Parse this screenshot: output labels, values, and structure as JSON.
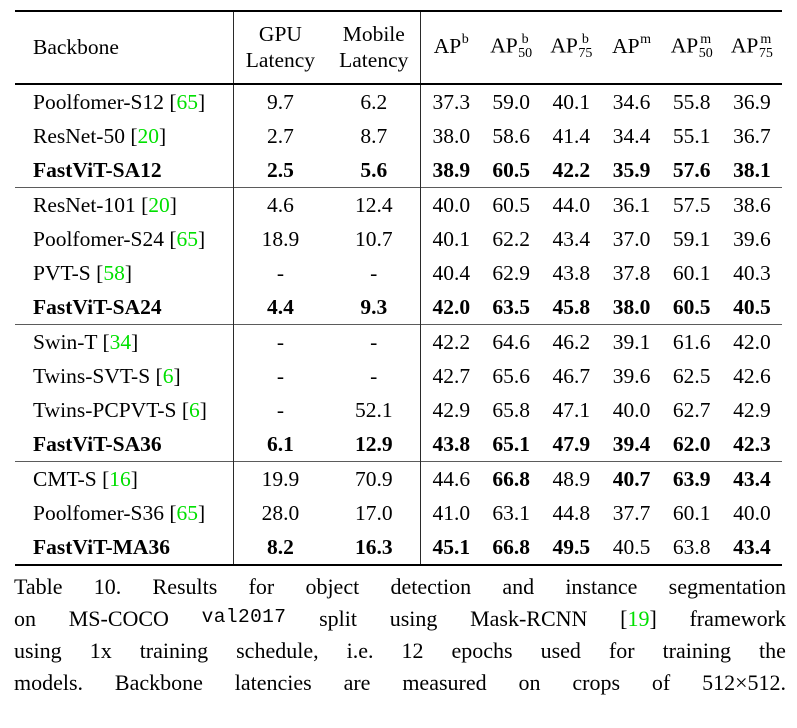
{
  "table": {
    "number": "Table 10",
    "headers": {
      "backbone": "Backbone",
      "gpu_latency": [
        "GPU",
        "Latency"
      ],
      "mobile_latency": [
        "Mobile",
        "Latency"
      ],
      "metrics": [
        {
          "base": "AP",
          "sup": "b",
          "sub": ""
        },
        {
          "base": "AP",
          "sup": "b",
          "sub": "50"
        },
        {
          "base": "AP",
          "sup": "b",
          "sub": "75"
        },
        {
          "base": "AP",
          "sup": "m",
          "sub": ""
        },
        {
          "base": "AP",
          "sup": "m",
          "sub": "50"
        },
        {
          "base": "AP",
          "sup": "m",
          "sub": "75"
        }
      ]
    },
    "groups": [
      {
        "rows": [
          {
            "name": "Poolfomer-S12",
            "cite": "65",
            "bold_name": false,
            "gpu": "9.7",
            "mobile": "6.2",
            "bold_latency": false,
            "values": [
              "37.3",
              "59.0",
              "40.1",
              "34.6",
              "55.8",
              "36.9"
            ],
            "bold_values": [
              false,
              false,
              false,
              false,
              false,
              false
            ]
          },
          {
            "name": "ResNet-50",
            "cite": "20",
            "bold_name": false,
            "gpu": "2.7",
            "mobile": "8.7",
            "bold_latency": false,
            "values": [
              "38.0",
              "58.6",
              "41.4",
              "34.4",
              "55.1",
              "36.7"
            ],
            "bold_values": [
              false,
              false,
              false,
              false,
              false,
              false
            ]
          },
          {
            "name": "FastViT-SA12",
            "cite": "",
            "bold_name": true,
            "gpu": "2.5",
            "mobile": "5.6",
            "bold_latency": true,
            "values": [
              "38.9",
              "60.5",
              "42.2",
              "35.9",
              "57.6",
              "38.1"
            ],
            "bold_values": [
              true,
              true,
              true,
              true,
              true,
              true
            ]
          }
        ]
      },
      {
        "rows": [
          {
            "name": "ResNet-101",
            "cite": "20",
            "bold_name": false,
            "gpu": "4.6",
            "mobile": "12.4",
            "bold_latency": false,
            "values": [
              "40.0",
              "60.5",
              "44.0",
              "36.1",
              "57.5",
              "38.6"
            ],
            "bold_values": [
              false,
              false,
              false,
              false,
              false,
              false
            ]
          },
          {
            "name": "Poolfomer-S24",
            "cite": "65",
            "bold_name": false,
            "gpu": "18.9",
            "mobile": "10.7",
            "bold_latency": false,
            "values": [
              "40.1",
              "62.2",
              "43.4",
              "37.0",
              "59.1",
              "39.6"
            ],
            "bold_values": [
              false,
              false,
              false,
              false,
              false,
              false
            ]
          },
          {
            "name": "PVT-S",
            "cite": "58",
            "bold_name": false,
            "gpu": "-",
            "mobile": "-",
            "bold_latency": false,
            "values": [
              "40.4",
              "62.9",
              "43.8",
              "37.8",
              "60.1",
              "40.3"
            ],
            "bold_values": [
              false,
              false,
              false,
              false,
              false,
              false
            ]
          },
          {
            "name": "FastViT-SA24",
            "cite": "",
            "bold_name": true,
            "gpu": "4.4",
            "mobile": "9.3",
            "bold_latency": true,
            "values": [
              "42.0",
              "63.5",
              "45.8",
              "38.0",
              "60.5",
              "40.5"
            ],
            "bold_values": [
              true,
              true,
              true,
              true,
              true,
              true
            ]
          }
        ]
      },
      {
        "rows": [
          {
            "name": "Swin-T",
            "cite": "34",
            "bold_name": false,
            "gpu": "-",
            "mobile": "-",
            "bold_latency": false,
            "values": [
              "42.2",
              "64.6",
              "46.2",
              "39.1",
              "61.6",
              "42.0"
            ],
            "bold_values": [
              false,
              false,
              false,
              false,
              false,
              false
            ]
          },
          {
            "name": "Twins-SVT-S",
            "cite": "6",
            "bold_name": false,
            "gpu": "-",
            "mobile": "-",
            "bold_latency": false,
            "values": [
              "42.7",
              "65.6",
              "46.7",
              "39.6",
              "62.5",
              "42.6"
            ],
            "bold_values": [
              false,
              false,
              false,
              false,
              false,
              false
            ]
          },
          {
            "name": "Twins-PCPVT-S",
            "cite": "6",
            "bold_name": false,
            "gpu": "-",
            "mobile": "52.1",
            "bold_latency": false,
            "values": [
              "42.9",
              "65.8",
              "47.1",
              "40.0",
              "62.7",
              "42.9"
            ],
            "bold_values": [
              false,
              false,
              false,
              false,
              false,
              false
            ]
          },
          {
            "name": "FastViT-SA36",
            "cite": "",
            "bold_name": true,
            "gpu": "6.1",
            "mobile": "12.9",
            "bold_latency": true,
            "values": [
              "43.8",
              "65.1",
              "47.9",
              "39.4",
              "62.0",
              "42.3"
            ],
            "bold_values": [
              true,
              true,
              true,
              true,
              true,
              true
            ]
          }
        ]
      },
      {
        "rows": [
          {
            "name": "CMT-S",
            "cite": "16",
            "bold_name": false,
            "gpu": "19.9",
            "mobile": "70.9",
            "bold_latency": false,
            "values": [
              "44.6",
              "66.8",
              "48.9",
              "40.7",
              "63.9",
              "43.4"
            ],
            "bold_values": [
              false,
              true,
              false,
              true,
              true,
              true
            ]
          },
          {
            "name": "Poolfomer-S36",
            "cite": "65",
            "bold_name": false,
            "gpu": "28.0",
            "mobile": "17.0",
            "bold_latency": false,
            "values": [
              "41.0",
              "63.1",
              "44.8",
              "37.7",
              "60.1",
              "40.0"
            ],
            "bold_values": [
              false,
              false,
              false,
              false,
              false,
              false
            ]
          },
          {
            "name": "FastViT-MA36",
            "cite": "",
            "bold_name": true,
            "gpu": "8.2",
            "mobile": "16.3",
            "bold_latency": true,
            "values": [
              "45.1",
              "66.8",
              "49.5",
              "40.5",
              "63.8",
              "43.4"
            ],
            "bold_values": [
              true,
              true,
              true,
              false,
              false,
              true
            ]
          }
        ]
      }
    ]
  },
  "caption": {
    "line1": "Table 10.  Results for object detection and instance segmentation",
    "line2_a": "on MS-COCO",
    "line2_mono": "val2017",
    "line2_b": "split using Mask-RCNN",
    "line2_cite": "19",
    "line2_c": "framework",
    "line3": "using 1x training schedule, i.e.  12 epochs used for training the",
    "line4": "models. Backbone latencies are measured on crops of 512×512."
  },
  "colors": {
    "citation_green": "#00e000",
    "rule_black": "#000000",
    "rule_gray": "#5b5b5b",
    "text": "#000000"
  }
}
